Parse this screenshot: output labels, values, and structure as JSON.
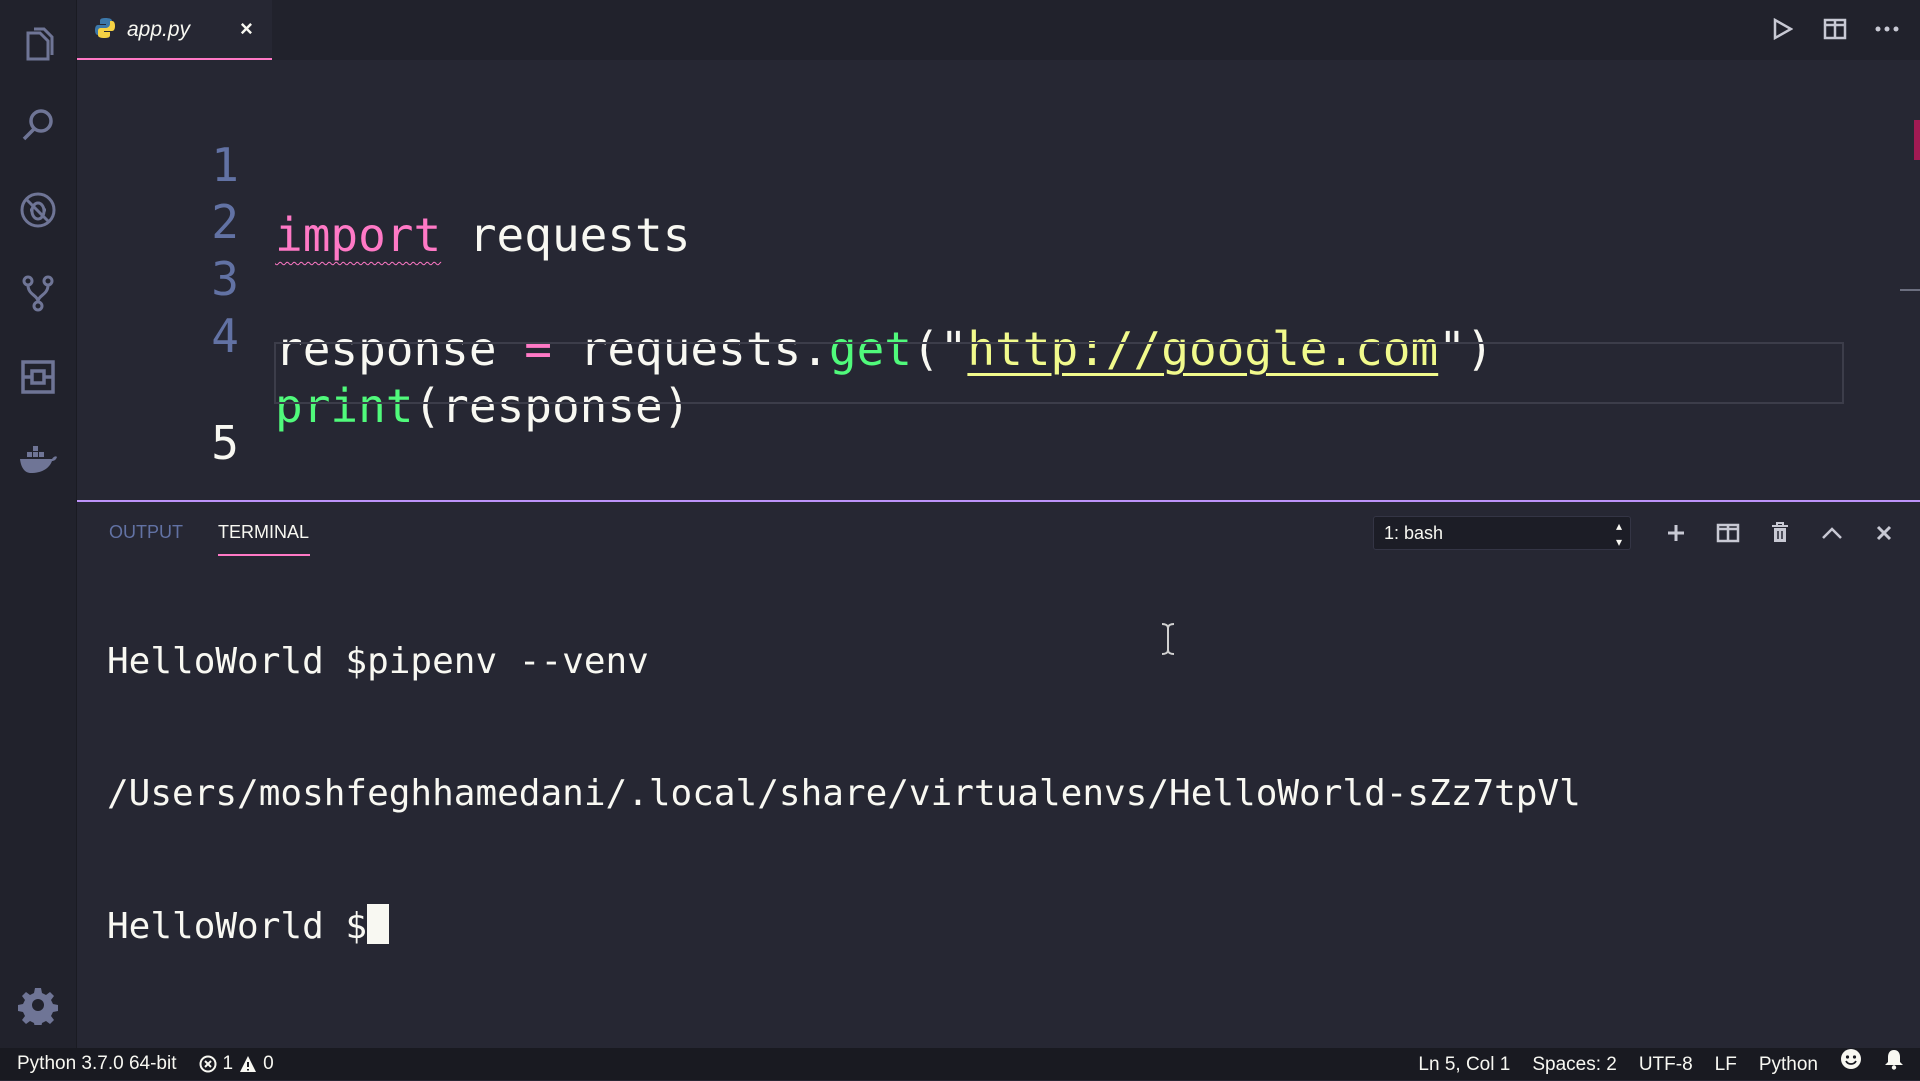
{
  "tab": {
    "filename": "app.py",
    "close_glyph": "×"
  },
  "editor": {
    "lines": [
      {
        "number": "1",
        "tokens": {
          "kw": "import",
          "rest": " requests"
        }
      },
      {
        "number": "2"
      },
      {
        "number": "3",
        "tokens": {
          "a": "response ",
          "op": "=",
          "b": " requests.",
          "fn": "get",
          "open": "(\"",
          "url": "http://google.com",
          "close": "\")"
        }
      },
      {
        "number": "4",
        "tokens": {
          "fn": "print",
          "rest": "(response)"
        }
      },
      {
        "number": "5"
      }
    ]
  },
  "panel": {
    "tabs": {
      "output": "OUTPUT",
      "terminal": "TERMINAL"
    },
    "terminal_select": "1: bash",
    "terminal_lines": [
      "HelloWorld $pipenv --venv",
      "/Users/moshfeghhamedani/.local/share/virtualenvs/HelloWorld-sZz7tpVl",
      "HelloWorld $"
    ]
  },
  "statusbar": {
    "interpreter": "Python 3.7.0 64-bit",
    "errors": "1",
    "warnings": "0",
    "position": "Ln 5, Col 1",
    "spaces": "Spaces: 2",
    "encoding": "UTF-8",
    "eol": "LF",
    "language": "Python"
  },
  "colors": {
    "accent_pink": "#ff79c6",
    "accent_purple": "#bd93f9",
    "green": "#50fa7b",
    "yellow": "#f1fa8c",
    "background": "#262733"
  }
}
